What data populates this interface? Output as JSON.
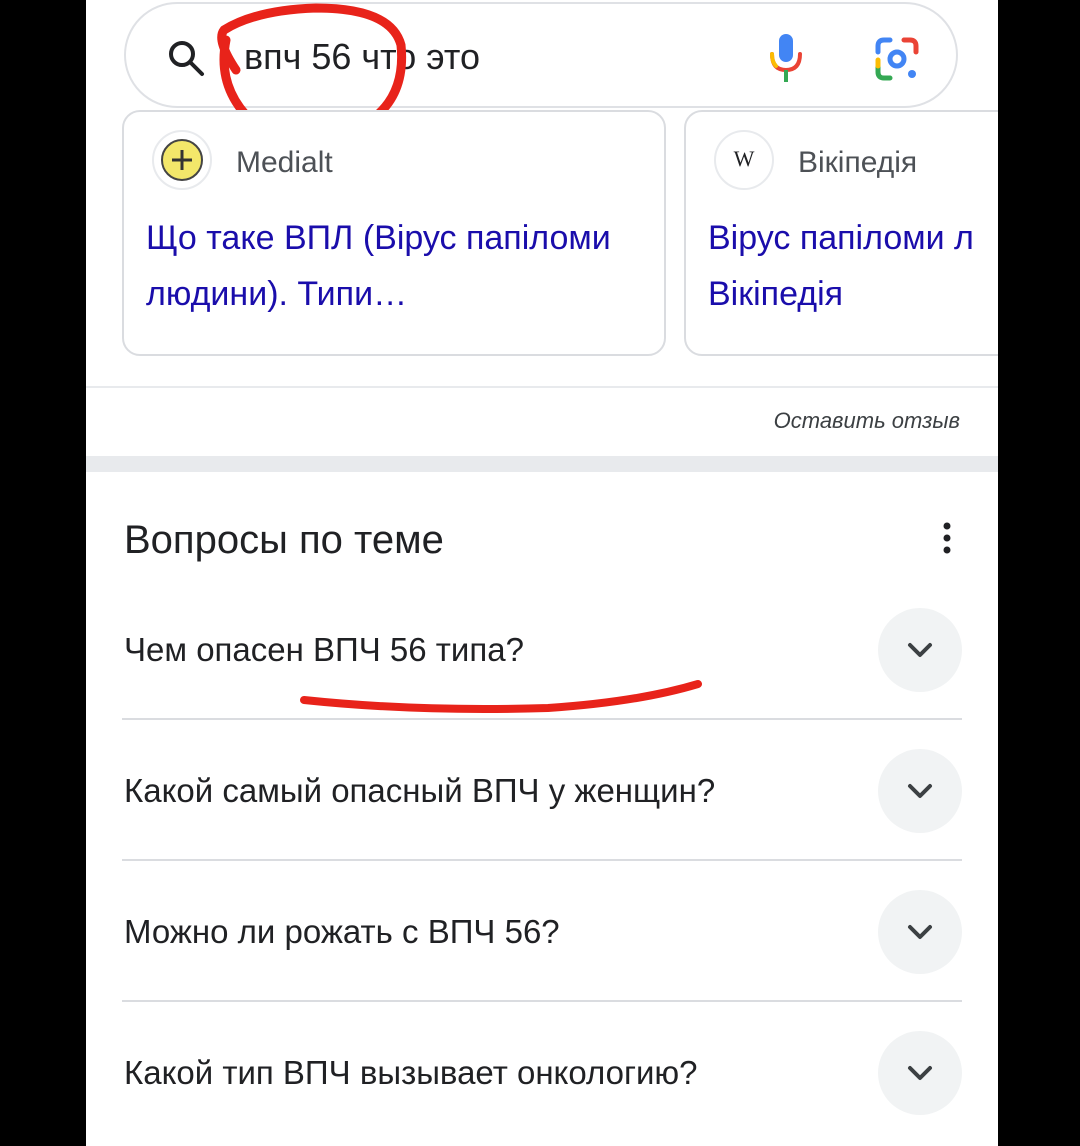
{
  "search": {
    "query": "впч 56 что это"
  },
  "cards": [
    {
      "source": "Medialt",
      "title": "Що таке ВПЛ (Вірус папіломи людини). Типи…"
    },
    {
      "source": "Вікіпедія",
      "logo_text": "W",
      "title_line1": "Вірус папіломи л",
      "title_line2": "Вікіпедія"
    }
  ],
  "feedback_label": "Оставить отзыв",
  "related": {
    "title": "Вопросы по теме",
    "questions": [
      "Чем опасен ВПЧ 56 типа?",
      "Какой самый опасный ВПЧ у женщин?",
      "Можно ли рожать с ВПЧ 56?",
      "Какой тип ВПЧ вызывает онкологию?"
    ]
  },
  "colors": {
    "link": "#1a0dab",
    "annotation": "#e8231a",
    "google_blue": "#4285f4",
    "google_red": "#ea4335",
    "google_yellow": "#fbbc04",
    "google_green": "#34a853"
  },
  "icons": [
    "search-icon",
    "mic-icon",
    "lens-icon",
    "more-vert-icon",
    "chevron-down-icon"
  ]
}
